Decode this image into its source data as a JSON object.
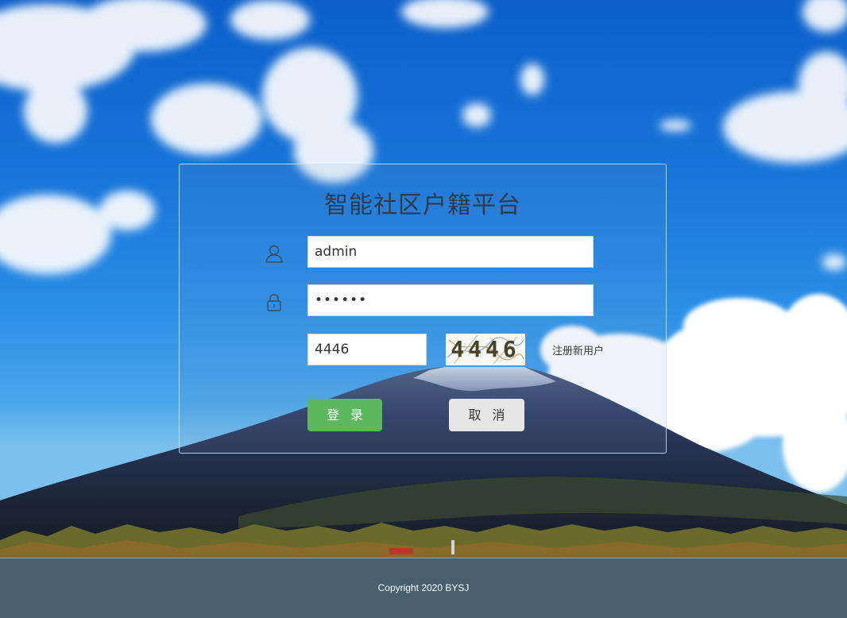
{
  "app": {
    "title": "智能社区户籍平台"
  },
  "form": {
    "username": {
      "value": "admin",
      "icon": "user-icon"
    },
    "password": {
      "value": "••••••",
      "icon": "lock-icon"
    },
    "captcha": {
      "value": "4446",
      "image_text": "4446"
    },
    "register_label": "注册新用户",
    "login_label": "登录",
    "cancel_label": "取消"
  },
  "footer": {
    "copyright": "Copyright 2020 BYSJ"
  },
  "colors": {
    "login_button": "#5cb85c",
    "cancel_button": "#e6e6e6",
    "footer_bg": "#46606e",
    "sky": "#1a78db"
  }
}
